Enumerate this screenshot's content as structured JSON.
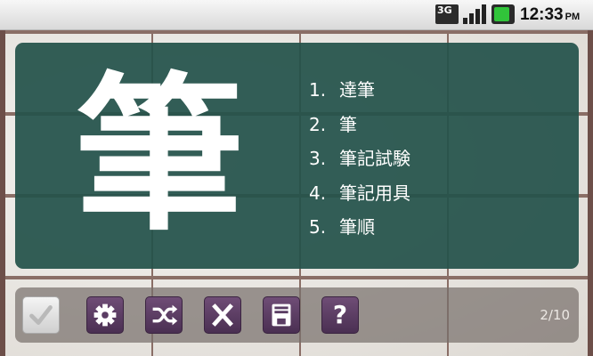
{
  "status_bar": {
    "network": "3G",
    "time": "12:33",
    "ampm": "PM",
    "icons": [
      "3g-icon",
      "signal-icon",
      "battery-icon"
    ]
  },
  "card": {
    "kanji": "筆",
    "words": [
      {
        "num": "1.",
        "text": "達筆"
      },
      {
        "num": "2.",
        "text": "筆"
      },
      {
        "num": "3.",
        "text": "筆記試験"
      },
      {
        "num": "4.",
        "text": "筆記用具"
      },
      {
        "num": "5.",
        "text": "筆順"
      }
    ]
  },
  "toolbar": {
    "buttons": [
      {
        "name": "check-button",
        "icon": "check-icon"
      },
      {
        "name": "settings-button",
        "icon": "gear-icon"
      },
      {
        "name": "shuffle-button",
        "icon": "shuffle-icon"
      },
      {
        "name": "delete-button",
        "icon": "close-icon"
      },
      {
        "name": "save-button",
        "icon": "save-icon"
      },
      {
        "name": "help-button",
        "icon": "help-icon",
        "label": "?"
      }
    ],
    "counter": "2/10"
  },
  "colors": {
    "board": "#24524a",
    "toolbar_button": "#5a3c63",
    "battery": "#31c43a"
  }
}
